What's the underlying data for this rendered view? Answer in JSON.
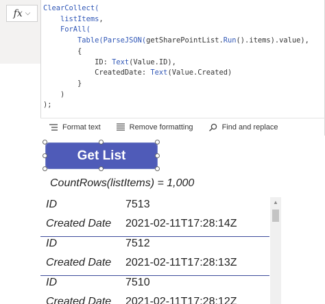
{
  "formula_bar": {
    "fx_label": "fx",
    "code_lines": [
      [
        [
          "fn",
          "ClearCollect("
        ]
      ],
      [
        [
          "plain",
          "    "
        ],
        [
          "id",
          "listItems"
        ],
        [
          "plain",
          ","
        ]
      ],
      [
        [
          "plain",
          "    "
        ],
        [
          "fn",
          "ForAll("
        ]
      ],
      [
        [
          "plain",
          "        "
        ],
        [
          "fn",
          "Table("
        ],
        [
          "fn",
          "ParseJSON("
        ],
        [
          "plain",
          "getSharePointList."
        ],
        [
          "fn",
          "Run"
        ],
        [
          "plain",
          "().items).value),"
        ]
      ],
      [
        [
          "plain",
          "        {"
        ]
      ],
      [
        [
          "plain",
          "            ID: "
        ],
        [
          "fn",
          "Text"
        ],
        [
          "plain",
          "(Value.ID),"
        ]
      ],
      [
        [
          "plain",
          "            CreatedDate: "
        ],
        [
          "fn",
          "Text"
        ],
        [
          "plain",
          "(Value.Created)"
        ]
      ],
      [
        [
          "plain",
          "        }"
        ]
      ],
      [
        [
          "plain",
          "    )"
        ]
      ],
      [
        [
          "plain",
          ");"
        ]
      ]
    ]
  },
  "toolbar": {
    "format_text": "Format text",
    "remove_formatting": "Remove formatting",
    "find_replace": "Find and replace"
  },
  "canvas": {
    "button_label": "Get List",
    "count_label": "CountRows(listItems) = 1,000"
  },
  "gallery": {
    "field_id": "ID",
    "field_created": "Created Date",
    "rows": [
      {
        "id": "7513",
        "created": "2021-02-11T17:28:14Z"
      },
      {
        "id": "7512",
        "created": "2021-02-11T17:28:13Z"
      },
      {
        "id": "7510",
        "created": "2021-02-11T17:28:12Z"
      }
    ]
  }
}
